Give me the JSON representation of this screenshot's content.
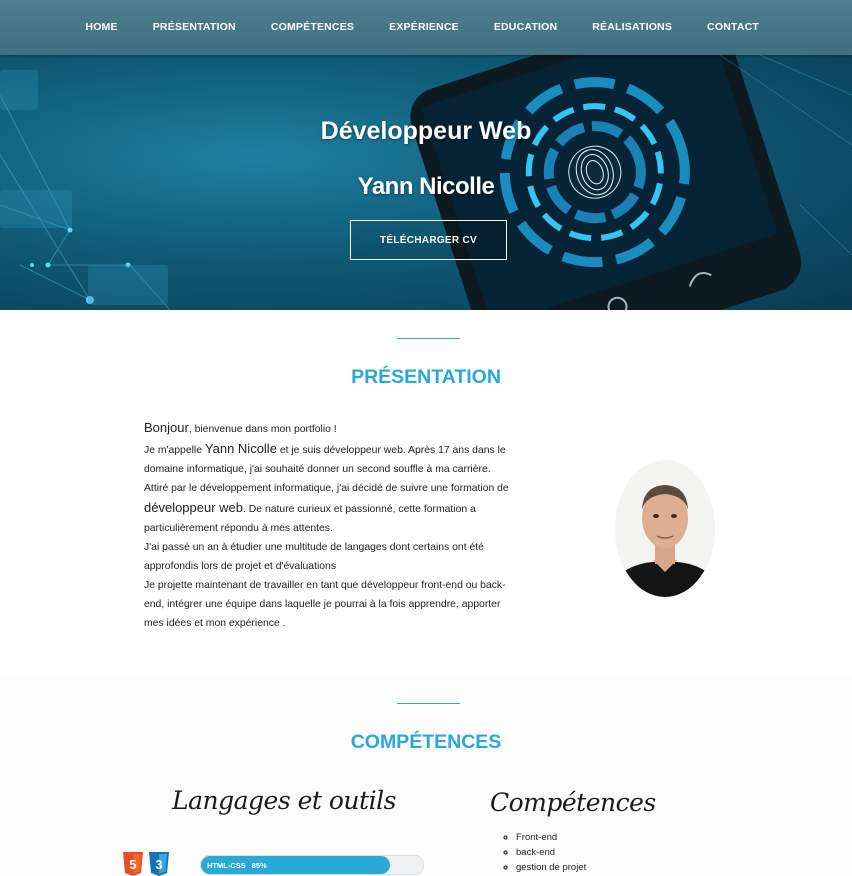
{
  "nav": {
    "items": [
      "HOME",
      "PRÉSENTATION",
      "COMPÉTENCES",
      "EXPÉRIENCE",
      "EDUCATION",
      "RÉALISATIONS",
      "CONTACT"
    ]
  },
  "hero": {
    "title": "Développeur Web",
    "name": "Yann Nicolle",
    "cv_button": "TÉLÉCHARGER  CV"
  },
  "presentation": {
    "title": "PRÉSENTATION",
    "greeting": "Bonjour",
    "line1_rest": ",  bienvenue dans mon portfolio !",
    "line2_a": "Je m'appelle ",
    "line2_name": "Yann Nicolle",
    "line2_b": " et je suis développeur web.  Après 17 ans dans le domaine informatique,  j'ai souhaité donner un second souffle à ma carrière.  Attiré par le développement informatique,   j'ai décidé de suivre une formation de ",
    "line2_job": "développeur web",
    "line2_c": ".  De nature curieux et passionné, cette formation a particulièrement répondu à mes attentes.",
    "line3": "J'ai passé un an à étudier une multitude de langages dont certains ont été approfondis lors de projet et d'évaluations",
    "line4": "Je projette maintenant de travailler en tant que développeur front-end ou back-end,  intégrer une équipe dans laquelle je pourrai à la fois apprendre, apporter mes idées et mon expérience ."
  },
  "skills": {
    "title": "COMPÉTENCES",
    "languages_heading": "Langages et outils",
    "competences_heading": "Compétences",
    "competences": [
      "Front-end",
      "back-end",
      "gestion de projet"
    ],
    "bars": [
      {
        "label": "HTML-CSS",
        "percent_label": "85%",
        "level": 0.85
      }
    ]
  },
  "colors": {
    "accent": "#29a9d8",
    "nav": "#46788a"
  }
}
